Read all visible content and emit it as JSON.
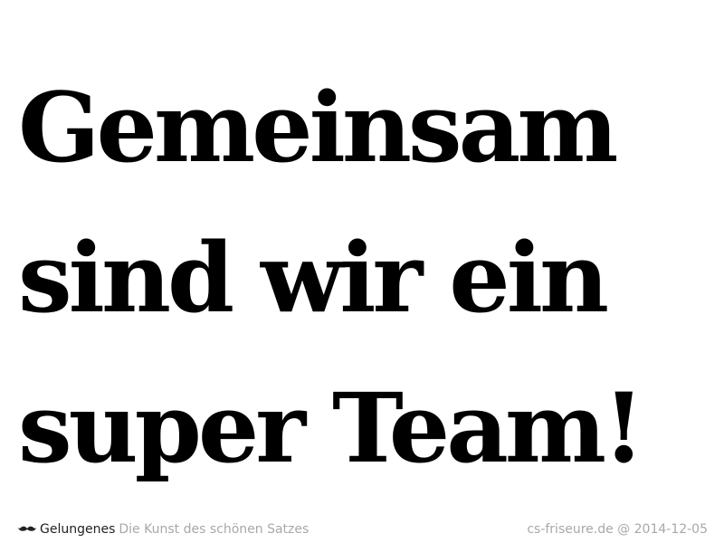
{
  "quote": {
    "lines": [
      "Gemeinsam",
      "sind wir ein",
      "super Team!"
    ]
  },
  "footer": {
    "logo_icon": "mustache-icon",
    "brand": "Gelungenes",
    "tagline": "Die Kunst des schönen Satzes",
    "source": "cs-friseure.de @ 2014-12-05"
  },
  "colors": {
    "text": "#000000",
    "muted": "#a8a8a8",
    "brand": "#222222",
    "background": "#ffffff"
  }
}
